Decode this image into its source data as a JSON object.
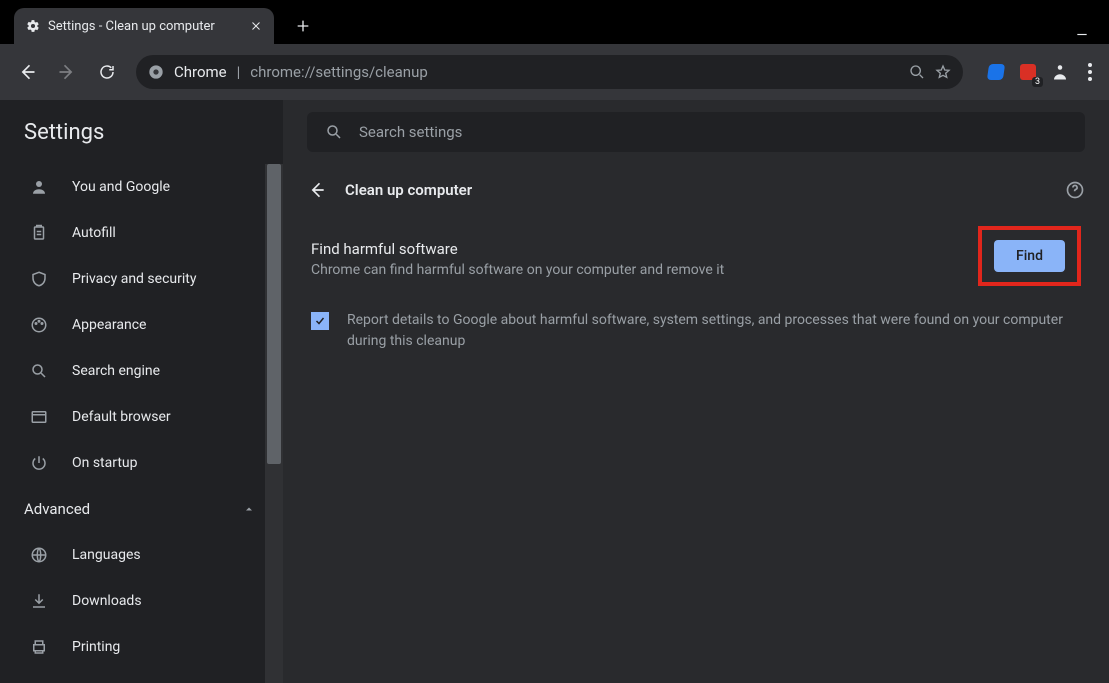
{
  "window": {
    "tab_title": "Settings - Clean up computer"
  },
  "toolbar": {
    "url_host": "Chrome",
    "url_path": "chrome://settings/cleanup",
    "ext_badge": "3"
  },
  "sidebar": {
    "title": "Settings",
    "items": [
      {
        "label": "You and Google"
      },
      {
        "label": "Autofill"
      },
      {
        "label": "Privacy and security"
      },
      {
        "label": "Appearance"
      },
      {
        "label": "Search engine"
      },
      {
        "label": "Default browser"
      },
      {
        "label": "On startup"
      }
    ],
    "advanced_label": "Advanced",
    "adv_items": [
      {
        "label": "Languages"
      },
      {
        "label": "Downloads"
      },
      {
        "label": "Printing"
      }
    ]
  },
  "search": {
    "placeholder": "Search settings"
  },
  "content": {
    "header": "Clean up computer",
    "find_title": "Find harmful software",
    "find_sub": "Chrome can find harmful software on your computer and remove it",
    "find_button": "Find",
    "report_text": "Report details to Google about harmful software, system settings, and processes that were found on your computer during this cleanup"
  }
}
